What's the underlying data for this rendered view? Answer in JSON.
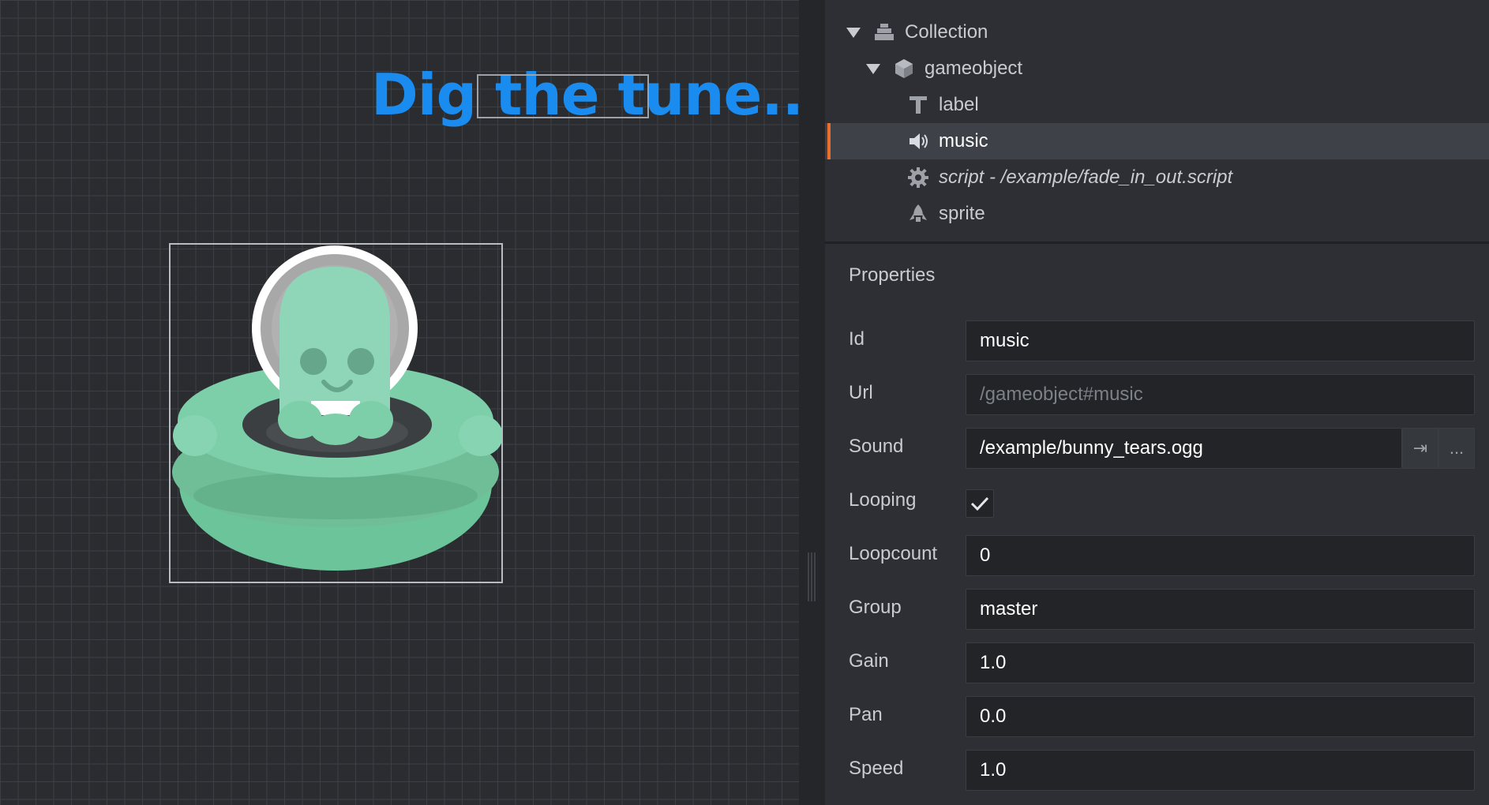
{
  "scene": {
    "label_text": "Dig the tune..."
  },
  "outline": {
    "items": [
      {
        "name": "Collection",
        "icon": "collection-icon"
      },
      {
        "name": "gameobject",
        "icon": "gameobject-icon"
      },
      {
        "name": "label",
        "icon": "text-icon"
      },
      {
        "name": "music",
        "icon": "speaker-icon",
        "selected": true
      },
      {
        "name": "script - /example/fade_in_out.script",
        "icon": "gear-icon"
      },
      {
        "name": "sprite",
        "icon": "sprite-icon"
      }
    ]
  },
  "properties": {
    "title": "Properties",
    "id": {
      "label": "Id",
      "value": "music"
    },
    "url": {
      "label": "Url",
      "value": "/gameobject#music"
    },
    "sound": {
      "label": "Sound",
      "value": "/example/bunny_tears.ogg",
      "open_label": "⇥",
      "browse_label": "..."
    },
    "looping": {
      "label": "Looping",
      "checked": true
    },
    "loopcount": {
      "label": "Loopcount",
      "value": "0"
    },
    "group": {
      "label": "Group",
      "value": "master"
    },
    "gain": {
      "label": "Gain",
      "value": "1.0"
    },
    "pan": {
      "label": "Pan",
      "value": "0.0"
    },
    "speed": {
      "label": "Speed",
      "value": "1.0"
    }
  },
  "colors": {
    "accent": "#e8702a",
    "label_blue": "#1a8cf0",
    "ufo_green": "#7ccfa9"
  }
}
